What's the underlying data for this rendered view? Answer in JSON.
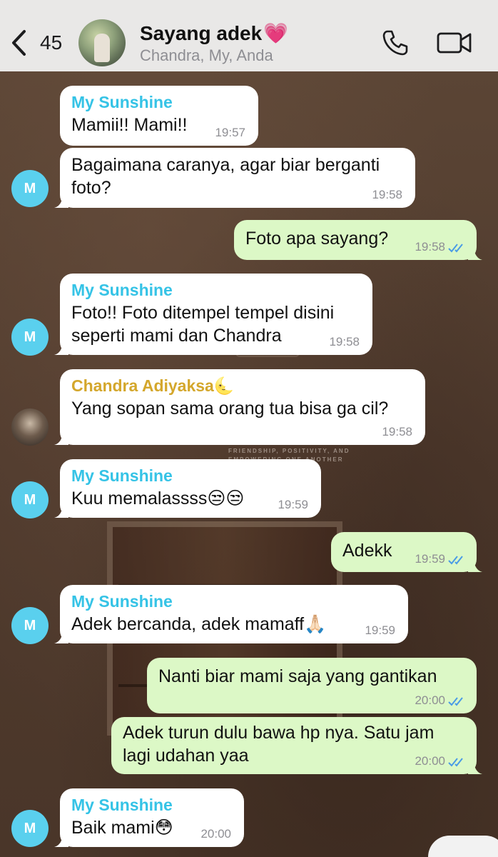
{
  "header": {
    "back_count": "45",
    "title": "Sayang adek",
    "title_emoji": "💗",
    "subtitle": "Chandra, My, Anda"
  },
  "messages": [
    {
      "dir": "in",
      "sender": "My Sunshine",
      "text": "Mamii!! Mami!!",
      "time": "19:57"
    },
    {
      "dir": "in",
      "text": "Bagaimana caranya, agar biar berganti foto?",
      "time": "19:58"
    },
    {
      "dir": "out",
      "text": "Foto apa sayang?",
      "time": "19:58"
    },
    {
      "dir": "in",
      "sender": "My Sunshine",
      "text": "Foto!! Foto ditempel tempel disini seperti mami dan Chandra",
      "time": "19:58"
    },
    {
      "dir": "in",
      "sender": "Chandra Adiyaksa🌜",
      "text": "Yang sopan sama orang tua bisa ga cil?",
      "time": "19:58"
    },
    {
      "dir": "in",
      "sender": "My Sunshine",
      "text": "Kuu memalassss😒😒",
      "time": "19:59"
    },
    {
      "dir": "out",
      "text": "Adekk",
      "time": "19:59"
    },
    {
      "dir": "in",
      "sender": "My Sunshine",
      "text": "Adek bercanda, adek mamaff🙏🏻",
      "time": "19:59"
    },
    {
      "dir": "out",
      "text": "Nanti biar mami saja yang gantikan",
      "time": "20:00"
    },
    {
      "dir": "out",
      "text": "Adek turun dulu bawa hp nya. Satu jam lagi udahan yaa",
      "time": "20:00"
    },
    {
      "dir": "in",
      "sender": "My Sunshine",
      "text": "Baik mami😳",
      "time": "20:00"
    }
  ],
  "avatars": {
    "my_sunshine_initial": "M"
  },
  "wallpaper": {
    "text": "FRIENDSHIP, POSITIVITY, AND EMPOWERING ONE ANOTHER"
  },
  "colors": {
    "header_bg": "#e9e8e7",
    "incoming_bubble": "#ffffff",
    "outgoing_bubble": "#dcf8c6",
    "sender_sunshine": "#35c3e6",
    "sender_chandra": "#d4a72c",
    "read_ticks": "#4a9be6"
  }
}
